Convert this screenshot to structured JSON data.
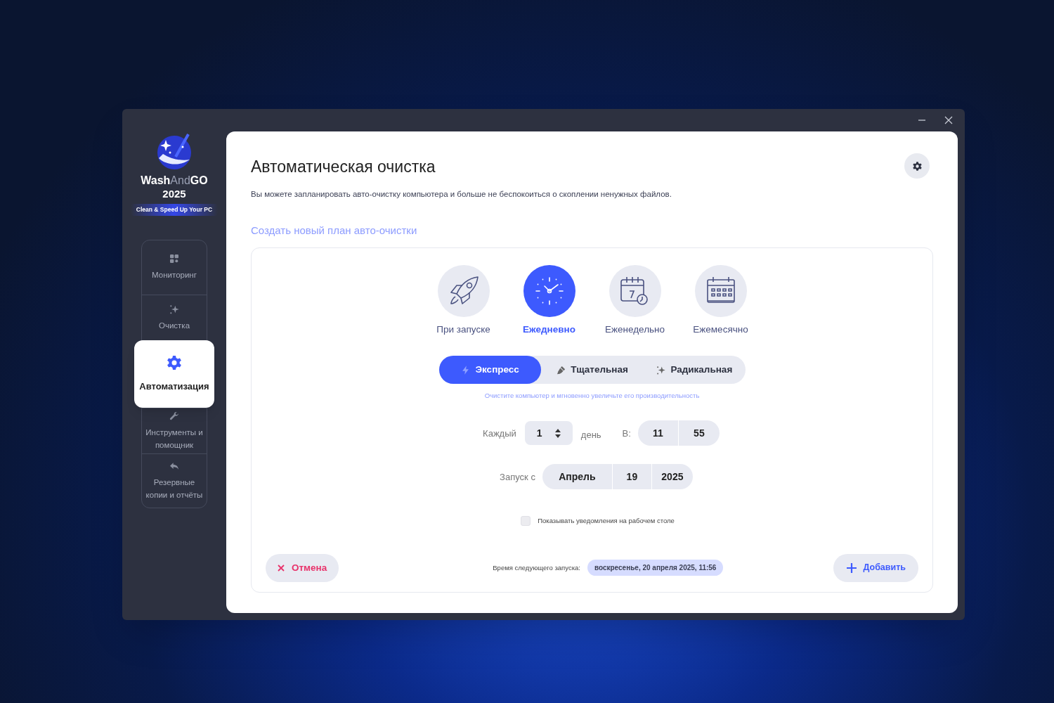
{
  "app": {
    "logo_parts": [
      "Wash",
      "And",
      "GO"
    ],
    "year": "2025",
    "tagline": "Clean & Speed Up Your PC"
  },
  "sidebar": {
    "items": [
      {
        "label": "Мониторинг",
        "kind": "grid",
        "selected": false
      },
      {
        "label": "Очистка",
        "kind": "sparkle",
        "selected": false
      },
      {
        "label": "Автоматизация",
        "kind": "gear",
        "selected": true
      },
      {
        "label": "Инструменты и помощник",
        "kind": "wrench",
        "selected": false
      },
      {
        "label": "Резервные копии и отчёты",
        "kind": "reply",
        "selected": false
      }
    ]
  },
  "page": {
    "title": "Автоматическая очистка",
    "description": "Вы можете запланировать авто-очистку компьютера и больше не беспокоиться о скоплении ненужных файлов.",
    "section_title": "Создать новый план авто-очистки"
  },
  "frequencies": [
    {
      "label": "При запуске",
      "kind": "rocket",
      "selected": false
    },
    {
      "label": "Ежедневно",
      "kind": "clock",
      "selected": true
    },
    {
      "label": "Еженедельно",
      "kind": "week",
      "selected": false
    },
    {
      "label": "Ежемесячно",
      "kind": "month",
      "selected": false
    }
  ],
  "modes": [
    {
      "label": "Экспресс",
      "kind": "bolt",
      "selected": true
    },
    {
      "label": "Тщательная",
      "kind": "brush",
      "selected": false
    },
    {
      "label": "Радикальная",
      "kind": "sparkle",
      "selected": false
    }
  ],
  "mode_hint": "Очистите компьютер и мгновенно увеличьте его производительность",
  "schedule": {
    "every_label": "Каждый",
    "every_value": "1",
    "unit_label": "день",
    "at_label": "В:",
    "hour": "11",
    "minute": "55",
    "start_label": "Запуск с",
    "month": "Апрель",
    "day": "19",
    "year": "2025"
  },
  "notifications": {
    "label": "Показывать уведомления на рабочем столе",
    "checked": false
  },
  "footer": {
    "cancel": "Отмена",
    "next_run_label": "Время следующего запуска:",
    "next_run": "воскресенье, 20 апреля 2025, 11:56",
    "add": "Добавить"
  }
}
